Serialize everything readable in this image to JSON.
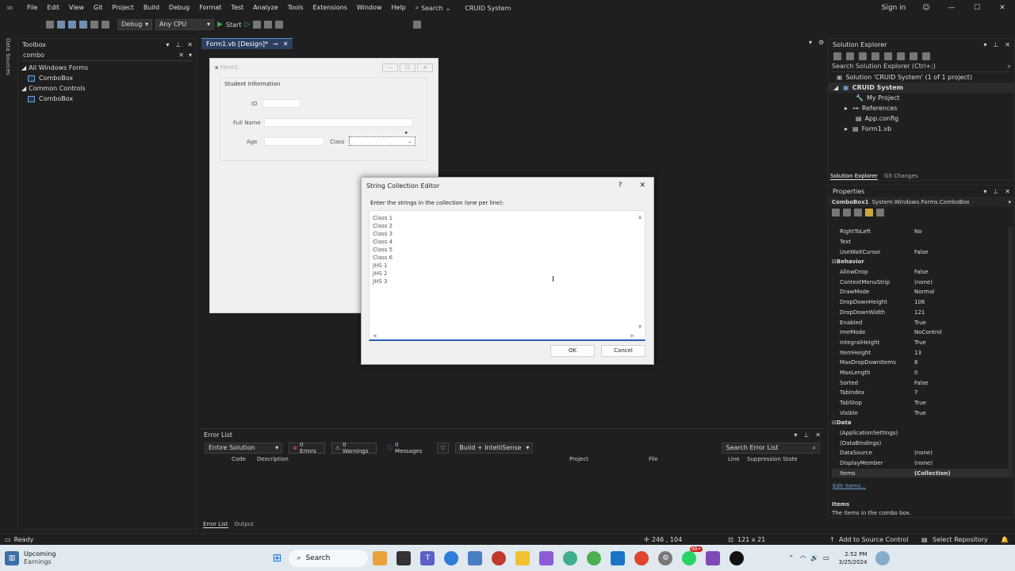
{
  "menubar": {
    "items": [
      "File",
      "Edit",
      "View",
      "Git",
      "Project",
      "Build",
      "Debug",
      "Format",
      "Test",
      "Analyze",
      "Tools",
      "Extensions",
      "Window",
      "Help"
    ],
    "search": "Search",
    "solution_title": "CRUID System",
    "sign_in": "Sign in"
  },
  "toolbar": {
    "config": "Debug",
    "platform": "Any CPU",
    "start": "Start"
  },
  "side_strip": {
    "label": "Data Sources"
  },
  "toolbox": {
    "title": "Toolbox",
    "search_value": "combo",
    "groups": [
      {
        "name": "All Windows Forms",
        "items": [
          "ComboBox"
        ]
      },
      {
        "name": "Common Controls",
        "items": [
          "ComboBox"
        ]
      }
    ]
  },
  "doc_tab": {
    "label": "Form1.vb [Design]*"
  },
  "form1": {
    "title": "Form1",
    "group_label": "Student Information",
    "id_label": "ID",
    "fullname_label": "Full Name",
    "age_label": "Age",
    "class_label": "Class"
  },
  "dialog": {
    "title": "String Collection Editor",
    "help": "?",
    "prompt": "Enter the strings in the collection (one per line):",
    "lines": [
      "Class 1",
      "Class 2",
      "Class 3",
      "Class 4",
      "Class 5",
      "Class 6",
      "JHS 1",
      "JHS 2",
      "JHS 3"
    ],
    "ok": "OK",
    "cancel": "Cancel"
  },
  "error_list": {
    "title": "Error List",
    "scope": "Entire Solution",
    "errors": "0 Errors",
    "warnings": "0 Warnings",
    "messages": "0 Messages",
    "filter": "Build + IntelliSense",
    "search_placeholder": "Search Error List",
    "columns": [
      "Code",
      "Description",
      "Project",
      "File",
      "Line",
      "Suppression State"
    ],
    "tabs": [
      "Error List",
      "Output"
    ]
  },
  "solution_explorer": {
    "title": "Solution Explorer",
    "search_placeholder": "Search Solution Explorer (Ctrl+;)",
    "solution": "Solution 'CRUID System' (1 of 1 project)",
    "project": "CRUID System",
    "items": [
      "My Project",
      "References",
      "App.config",
      "Form1.vb"
    ],
    "tabs": [
      "Solution Explorer",
      "Git Changes"
    ]
  },
  "properties": {
    "title": "Properties",
    "object": "ComboBox1",
    "object_type": "System.Windows.Forms.ComboBox",
    "rows": [
      {
        "k": "RightToLeft",
        "v": "No"
      },
      {
        "k": "Text",
        "v": ""
      },
      {
        "k": "UseWaitCursor",
        "v": "False"
      },
      {
        "k": "Behavior",
        "v": "",
        "cat": true
      },
      {
        "k": "AllowDrop",
        "v": "False"
      },
      {
        "k": "ContextMenuStrip",
        "v": "(none)"
      },
      {
        "k": "DrawMode",
        "v": "Normal"
      },
      {
        "k": "DropDownHeight",
        "v": "106"
      },
      {
        "k": "DropDownWidth",
        "v": "121"
      },
      {
        "k": "Enabled",
        "v": "True"
      },
      {
        "k": "ImeMode",
        "v": "NoControl"
      },
      {
        "k": "IntegralHeight",
        "v": "True"
      },
      {
        "k": "ItemHeight",
        "v": "13"
      },
      {
        "k": "MaxDropDownItems",
        "v": "8"
      },
      {
        "k": "MaxLength",
        "v": "0"
      },
      {
        "k": "Sorted",
        "v": "False"
      },
      {
        "k": "TabIndex",
        "v": "7"
      },
      {
        "k": "TabStop",
        "v": "True"
      },
      {
        "k": "Visible",
        "v": "True"
      },
      {
        "k": "Data",
        "v": "",
        "cat": true
      },
      {
        "k": "(ApplicationSettings)",
        "v": ""
      },
      {
        "k": "(DataBindings)",
        "v": ""
      },
      {
        "k": "DataSource",
        "v": "(none)"
      },
      {
        "k": "DisplayMember",
        "v": "(none)"
      },
      {
        "k": "Items",
        "v": "(Collection)"
      }
    ],
    "edit_items": "Edit Items...",
    "desc_title": "Items",
    "desc_text": "The items in the combo box."
  },
  "statusbar": {
    "ready": "Ready",
    "position": "246 , 104",
    "size": "121 x 21",
    "source_control": "Add to Source Control",
    "repo": "Select Repository"
  },
  "taskbar": {
    "weather_title": "Upcoming",
    "weather_sub": "Earnings",
    "search": "Search",
    "time": "2:52 PM",
    "date": "3/25/2024",
    "badge": "99+"
  }
}
